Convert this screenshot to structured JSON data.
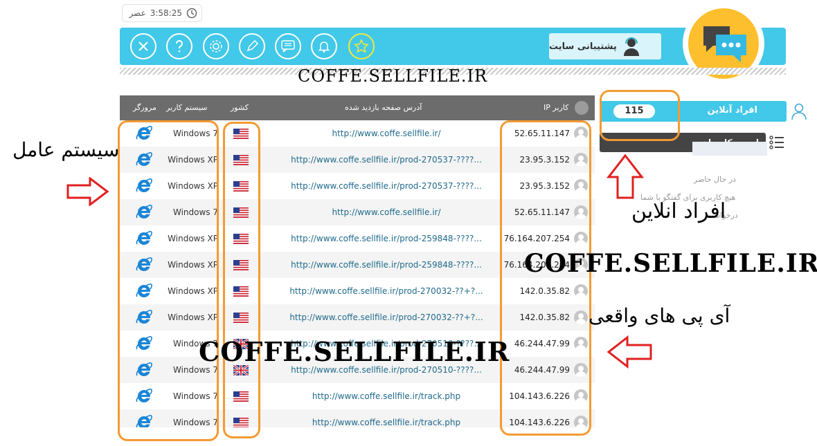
{
  "clock": {
    "period": "عصر",
    "time": "3:58:25"
  },
  "toolbar": {
    "support_label": "پشتیبانی سایت",
    "buttons": [
      "close-icon",
      "help-icon",
      "settings-icon",
      "edit-icon",
      "chat-icon",
      "bell-icon",
      "star-icon"
    ]
  },
  "watermark": "COFFE.SELLFILE.IR",
  "table": {
    "headers": {
      "browser": "مرورگر",
      "os": "سیستم کاربر",
      "country": "کشور",
      "page": "آدرس صفحه بازدید شده",
      "ip": "IP کاربر"
    },
    "rows": [
      {
        "os": "Windows 7",
        "flag": "us",
        "url": "http://www.coffe.sellfile.ir/",
        "ip": "52.65.11.147"
      },
      {
        "os": "Windows XP",
        "flag": "us",
        "url": "http://www.coffe.sellfile.ir/prod-270537-????...",
        "ip": "23.95.3.152"
      },
      {
        "os": "Windows XP",
        "flag": "us",
        "url": "http://www.coffe.sellfile.ir/prod-270537-????...",
        "ip": "23.95.3.152"
      },
      {
        "os": "Windows 7",
        "flag": "us",
        "url": "http://www.coffe.sellfile.ir/",
        "ip": "52.65.11.147"
      },
      {
        "os": "Windows XP",
        "flag": "us",
        "url": "http://www.coffe.sellfile.ir/prod-259848-????...",
        "ip": "76.164.207.254"
      },
      {
        "os": "Windows XP",
        "flag": "us",
        "url": "http://www.coffe.sellfile.ir/prod-259848-????...",
        "ip": "76.164.207.254"
      },
      {
        "os": "Windows XP",
        "flag": "us",
        "url": "http://www.coffe.sellfile.ir/prod-270032-??+?...",
        "ip": "142.0.35.82"
      },
      {
        "os": "Windows XP",
        "flag": "us",
        "url": "http://www.coffe.sellfile.ir/prod-270032-??+?...",
        "ip": "142.0.35.82"
      },
      {
        "os": "Windows 7",
        "flag": "gb",
        "url": "http://www.coffe.sellfile.ir/prod-270510-????...",
        "ip": "46.244.47.99"
      },
      {
        "os": "Windows 7",
        "flag": "gb",
        "url": "http://www.coffe.sellfile.ir/prod-270510-????...",
        "ip": "46.244.47.99"
      },
      {
        "os": "Windows 7",
        "flag": "us",
        "url": "http://www.coffe.sellfile.ir/track.php",
        "ip": "104.143.6.226"
      },
      {
        "os": "Windows 7",
        "flag": "us",
        "url": "http://www.coffe.sellfile.ir/track.php",
        "ip": "104.143.6.226"
      }
    ]
  },
  "sidebar": {
    "online_label": "افراد آنلاین",
    "online_count": "115",
    "users_label": "لیست کاربران",
    "status_lines": [
      "در حال حاضر",
      "هیچ کاربری برای گفتگو با شما",
      "درخواست"
    ]
  },
  "annotations": {
    "os": "سیستم عامل",
    "online": "افراد انلاین",
    "real_ip": "آی پی های واقعی"
  },
  "colors": {
    "toolbar": "#42c8e8",
    "annotation_box": "#f39a33",
    "arrow": "#e02020",
    "logo": "#fdbf2d"
  }
}
